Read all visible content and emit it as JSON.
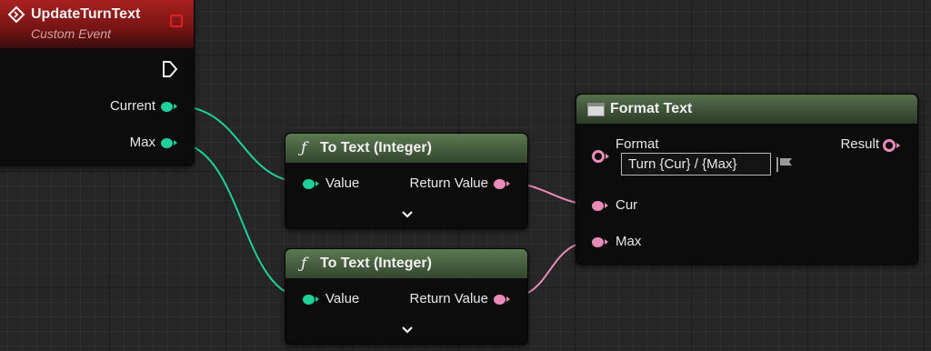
{
  "event_node": {
    "title": "UpdateTurnText",
    "subtitle": "Custom Event",
    "pins": {
      "current": "Current",
      "max": "Max"
    }
  },
  "to_text_1": {
    "icon": "ƒ",
    "title": "To Text (Integer)",
    "in": "Value",
    "out": "Return Value",
    "expand": "⌄"
  },
  "to_text_2": {
    "icon": "ƒ",
    "title": "To Text (Integer)",
    "in": "Value",
    "out": "Return Value",
    "expand": "⌄"
  },
  "format_node": {
    "title": "Format Text",
    "format_label": "Format",
    "format_value": "Turn {Cur} / {Max}",
    "result_label": "Result",
    "pins": {
      "cur": "Cur",
      "max": "Max"
    }
  },
  "colors": {
    "int_pin": "#1ed09a",
    "text_pin": "#e98bb9",
    "event_header": "#8c1a1a",
    "func_header": "#3f5a3a"
  }
}
